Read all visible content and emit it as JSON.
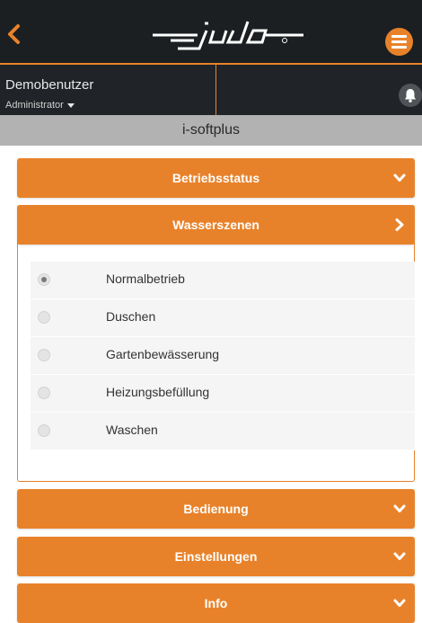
{
  "header": {
    "logo_text": "judo",
    "back_icon": "chevron-left-icon",
    "menu_icon": "hamburger-menu-icon"
  },
  "user": {
    "name": "Demobenutzer",
    "role": "Administrator",
    "notification_icon": "bell-icon"
  },
  "device_title": "i-softplus",
  "accordion": {
    "status_label": "Betriebsstatus",
    "scenes_label": "Wasserszenen",
    "operation_label": "Bedienung",
    "settings_label": "Einstellungen",
    "info_label": "Info"
  },
  "scenes": {
    "options": [
      {
        "label": "Normalbetrieb",
        "selected": true
      },
      {
        "label": "Duschen",
        "selected": false
      },
      {
        "label": "Gartenbewässerung",
        "selected": false
      },
      {
        "label": "Heizungsbefüllung",
        "selected": false
      },
      {
        "label": "Waschen",
        "selected": false
      }
    ]
  },
  "colors": {
    "accent": "#e8822a",
    "header_bg": "#1b1f22",
    "title_bar_bg": "#b2b2b2"
  }
}
